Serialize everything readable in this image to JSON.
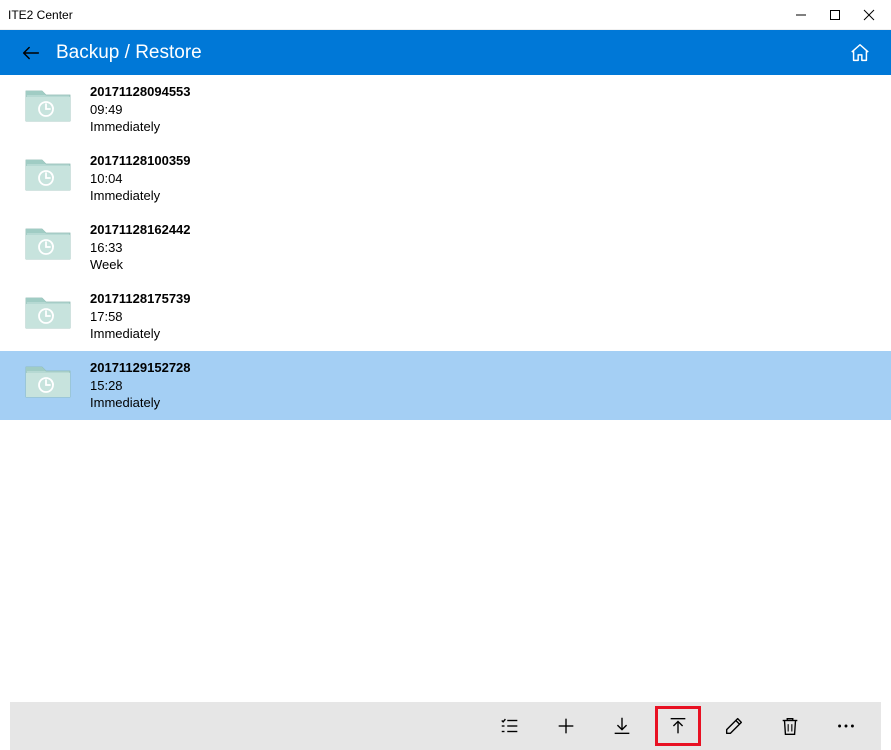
{
  "window": {
    "title": "ITE2 Center"
  },
  "header": {
    "title": "Backup / Restore"
  },
  "backups": [
    {
      "name": "20171128094553",
      "time": "09:49",
      "type": "Immediately",
      "selected": false
    },
    {
      "name": "20171128100359",
      "time": "10:04",
      "type": "Immediately",
      "selected": false
    },
    {
      "name": "20171128162442",
      "time": "16:33",
      "type": "Week",
      "selected": false
    },
    {
      "name": "20171128175739",
      "time": "17:58",
      "type": "Immediately",
      "selected": false
    },
    {
      "name": "20171129152728",
      "time": "15:28",
      "type": "Immediately",
      "selected": true
    }
  ],
  "toolbar": {
    "buttons": [
      {
        "id": "list-button",
        "icon": "list"
      },
      {
        "id": "add-button",
        "icon": "plus"
      },
      {
        "id": "download-button",
        "icon": "download"
      },
      {
        "id": "upload-button",
        "icon": "upload",
        "highlight": true
      },
      {
        "id": "edit-button",
        "icon": "pencil"
      },
      {
        "id": "delete-button",
        "icon": "trash"
      },
      {
        "id": "more-button",
        "icon": "dots"
      }
    ]
  }
}
